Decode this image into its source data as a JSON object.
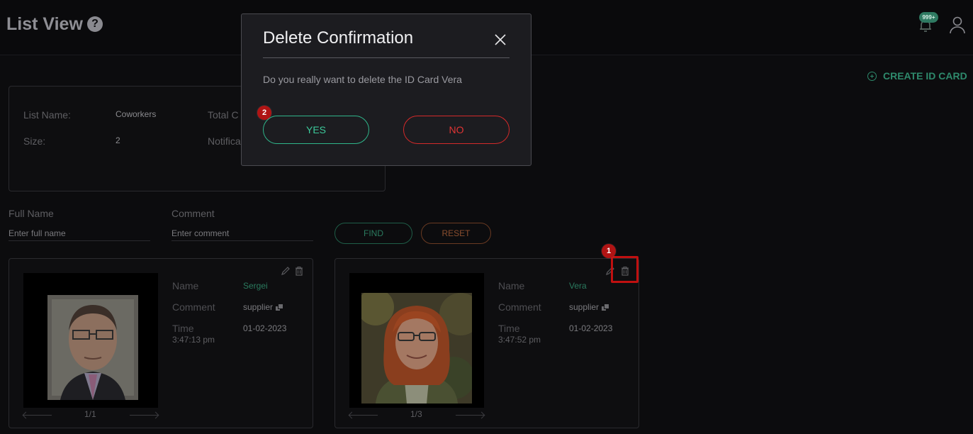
{
  "header": {
    "title": "List View",
    "help_icon": "?",
    "notification_count": "999+"
  },
  "toolbar": {
    "create_label": "CREATE ID CARD"
  },
  "list_info": {
    "name_label": "List Name:",
    "name_value": "Coworkers",
    "size_label": "Size:",
    "size_value": "2",
    "total_label": "Total C",
    "notif_label": "Notifica"
  },
  "filters": {
    "full_name_label": "Full Name",
    "full_name_placeholder": "Enter full name",
    "comment_label": "Comment",
    "comment_placeholder": "Enter comment",
    "find_label": "FIND",
    "reset_label": "RESET"
  },
  "cards": [
    {
      "name_label": "Name",
      "name": "Sergei",
      "comment_label": "Comment",
      "comment": "supplier",
      "time_label": "Time",
      "date": "01-02-2023",
      "time": "3:47:13 pm",
      "pager": "1/1"
    },
    {
      "name_label": "Name",
      "name": "Vera",
      "comment_label": "Comment",
      "comment": "supplier",
      "time_label": "Time",
      "date": "01-02-2023",
      "time": "3:47:52 pm",
      "pager": "1/3"
    }
  ],
  "annotations": {
    "step1": "1",
    "step2": "2"
  },
  "modal": {
    "title": "Delete Confirmation",
    "message": "Do you really want to delete the ID Card Vera",
    "yes_label": "YES",
    "no_label": "NO"
  },
  "colors": {
    "accent_green": "#3cc99a",
    "danger_red": "#e03434",
    "highlight_red": "#c01010"
  }
}
